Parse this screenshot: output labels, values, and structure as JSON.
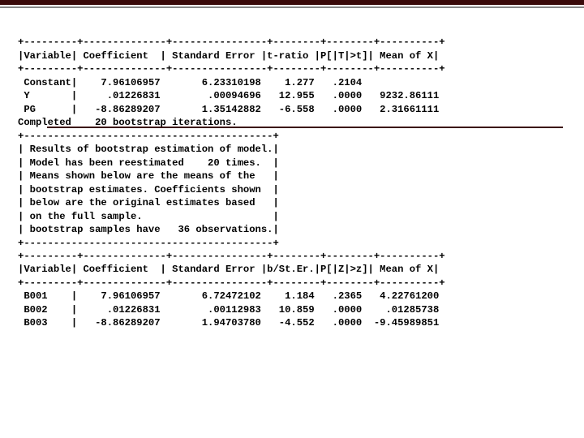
{
  "sep1": "+---------+--------------+----------------+--------+--------+----------+",
  "hdr1": "|Variable| Coefficient  | Standard Error |t-ratio |P[|T|>t]| Mean of X|",
  "sep1b": "+---------+--------------+----------------+--------+--------+----------+",
  "rows1": {
    "r0": " Constant|    7.96106957       6.23310198    1.277   .2104",
    "r1": " Y       |     .01226831        .00094696   12.955   .0000   9232.86111",
    "r2": " PG      |   -8.86289207       1.35142882   -6.558   .0000   2.31661111",
    "r3": "Completed    20 bootstrap iterations."
  },
  "boxsep": "+------------------------------------------+",
  "box": {
    "l0": "| Results of bootstrap estimation of model.|",
    "l1": "| Model has been reestimated    20 times.  |",
    "l2": "| Means shown below are the means of the   |",
    "l3": "| bootstrap estimates. Coefficients shown  |",
    "l4": "| below are the original estimates based   |",
    "l5": "| on the full sample.                      |",
    "l6": "| bootstrap samples have   36 observations.|"
  },
  "sep2": "+---------+--------------+----------------+--------+--------+----------+",
  "hdr2": "|Variable| Coefficient  | Standard Error |b/St.Er.|P[|Z|>z]| Mean of X|",
  "sep2b": "+---------+--------------+----------------+--------+--------+----------+",
  "rows2": {
    "r0": " B001    |    7.96106957       6.72472102    1.184   .2365   4.22761200",
    "r1": " B002    |     .01226831        .00112983   10.859   .0000    .01285738",
    "r2": " B003    |   -8.86289207       1.94703780   -4.552   .0000  -9.45989851"
  },
  "chart_data": [
    {
      "type": "table",
      "title": "Original regression estimates",
      "columns": [
        "Variable",
        "Coefficient",
        "Standard Error",
        "t-ratio",
        "P[|T|>t]",
        "Mean of X"
      ],
      "rows": [
        {
          "Variable": "Constant",
          "Coefficient": 7.96106957,
          "Standard Error": 6.23310198,
          "t-ratio": 1.277,
          "P[|T|>t]": 0.2104,
          "Mean of X": null
        },
        {
          "Variable": "Y",
          "Coefficient": 0.01226831,
          "Standard Error": 0.00094696,
          "t-ratio": 12.955,
          "P[|T|>t]": 0.0,
          "Mean of X": 9232.86111
        },
        {
          "Variable": "PG",
          "Coefficient": -8.86289207,
          "Standard Error": 1.35142882,
          "t-ratio": -6.558,
          "P[|T|>t]": 0.0,
          "Mean of X": 2.31661111
        }
      ],
      "notes": [
        "Completed 20 bootstrap iterations."
      ]
    },
    {
      "type": "table",
      "title": "Bootstrap estimation results",
      "columns": [
        "Variable",
        "Coefficient",
        "Standard Error",
        "b/St.Er.",
        "P[|Z|>z]",
        "Mean of X"
      ],
      "rows": [
        {
          "Variable": "B001",
          "Coefficient": 7.96106957,
          "Standard Error": 6.72472102,
          "b/St.Er.": 1.184,
          "P[|Z|>z]": 0.2365,
          "Mean of X": 4.227612
        },
        {
          "Variable": "B002",
          "Coefficient": 0.01226831,
          "Standard Error": 0.00112983,
          "b/St.Er.": 10.859,
          "P[|Z|>z]": 0.0,
          "Mean of X": 0.01285738
        },
        {
          "Variable": "B003",
          "Coefficient": -8.86289207,
          "Standard Error": 1.9470378,
          "b/St.Er.": -4.552,
          "P[|Z|>z]": 0.0,
          "Mean of X": -9.45989851
        }
      ],
      "notes": [
        "Results of bootstrap estimation of model.",
        "Model has been reestimated 20 times.",
        "Means shown below are the means of the bootstrap estimates.",
        "Coefficients shown below are the original estimates based on the full sample.",
        "bootstrap samples have 36 observations."
      ]
    }
  ]
}
